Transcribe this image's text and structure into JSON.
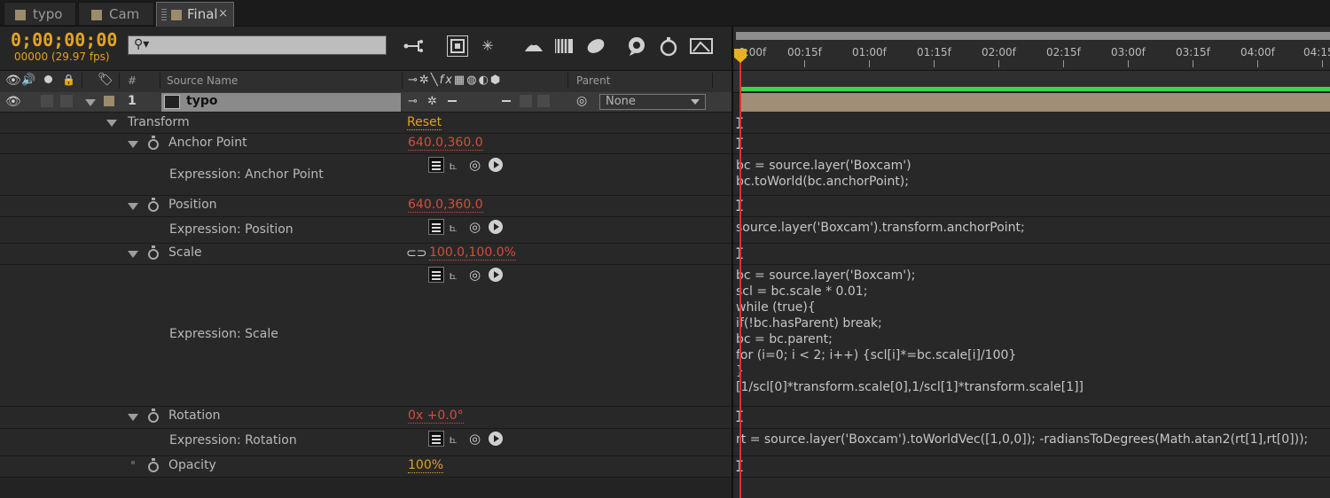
{
  "tabs": [
    {
      "label": "typo",
      "active": false
    },
    {
      "label": "Cam",
      "active": false
    },
    {
      "label": "Final",
      "active": true,
      "close": "×"
    }
  ],
  "toolbar": {
    "timecode": "0;00;00;00",
    "fps": "00000 (29.97 fps)",
    "search_placeholder": ""
  },
  "header": {
    "num": "#",
    "source_name": "Source Name",
    "parent": "Parent",
    "fx": "fx"
  },
  "layer": {
    "number": "1",
    "name": "typo",
    "parent_value": "None"
  },
  "properties": {
    "transform": {
      "label": "Transform",
      "reset": "Reset"
    },
    "anchor": {
      "label": "Anchor Point",
      "value": "640.0,360.0",
      "expr_label": "Expression: Anchor Point",
      "code": [
        "bc = source.layer('Boxcam')",
        "bc.toWorld(bc.anchorPoint);"
      ]
    },
    "position": {
      "label": "Position",
      "value": "640.0,360.0",
      "expr_label": "Expression: Position",
      "code": [
        "source.layer('Boxcam').transform.anchorPoint;"
      ]
    },
    "scale": {
      "label": "Scale",
      "value": "100.0,100.0%",
      "expr_label": "Expression: Scale",
      "code": [
        "bc = source.layer('Boxcam');",
        "scl = bc.scale * 0.01;",
        "while (true){",
        "if(!bc.hasParent) break;",
        "bc = bc.parent;",
        "for (i=0; i < 2; i++) {scl[i]*=bc.scale[i]/100}",
        "}",
        "[1/scl[0]*transform.scale[0],1/scl[1]*transform.scale[1]]"
      ]
    },
    "rotation": {
      "label": "Rotation",
      "value": "0x +0.0°",
      "expr_label": "Expression: Rotation",
      "code": [
        "rt = source.layer('Boxcam').toWorldVec([1,0,0]); -radiansToDegrees(Math.atan2(rt[1],rt[0]));"
      ]
    },
    "opacity": {
      "label": "Opacity",
      "value": "100%"
    }
  },
  "timeline": {
    "ticks": [
      "0:00f",
      "00:15f",
      "01:00f",
      "01:15f",
      "02:00f",
      "02:15f",
      "03:00f",
      "03:15f",
      "04:00f",
      "04:15"
    ]
  },
  "colors": {
    "timecode": "#e3a41e",
    "value_red": "#d14f3a",
    "value_yellow": "#e0a126",
    "cti": "#e2302a",
    "green_bar": "#3ed14a",
    "layer_bar": "#a08f76"
  }
}
